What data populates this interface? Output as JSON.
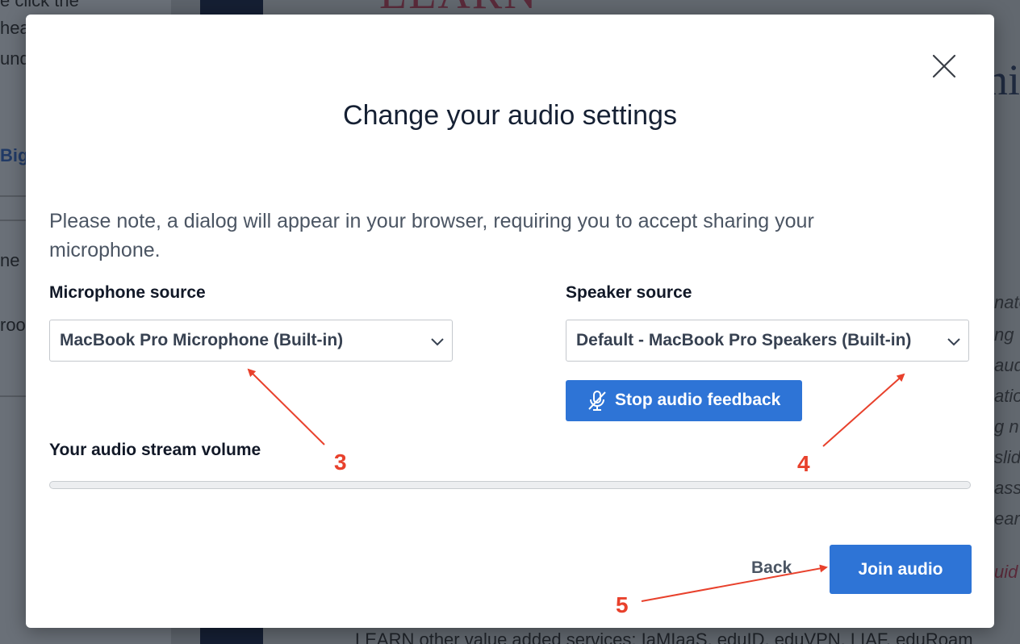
{
  "background": {
    "left_fragments": [
      "e click the",
      "hea",
      "und",
      "BigB",
      "ne n",
      "roo"
    ],
    "logo_fragment": "LEARN",
    "heading_fragment": "ni",
    "right_fragments": [
      "nato",
      "ng",
      "aud",
      "atio",
      "g n",
      "slid",
      "ass",
      "ear",
      "uid"
    ],
    "bottom_text": "LEARN other value added services: IaMIaaS, eduID, eduVPN, LIAF, eduRoam"
  },
  "modal": {
    "title": "Change your audio settings",
    "note": "Please note, a dialog will appear in your browser, requiring you to accept sharing your microphone.",
    "microphone": {
      "label": "Microphone source",
      "selected": "MacBook Pro Microphone (Built-in)"
    },
    "speaker": {
      "label": "Speaker source",
      "selected": "Default - MacBook Pro Speakers (Built-in)"
    },
    "feedback_button": "Stop audio feedback",
    "volume": {
      "label": "Your audio stream volume",
      "level": 0
    },
    "back_label": "Back",
    "join_label": "Join audio"
  },
  "annotations": {
    "color": "#e8412c",
    "labels": [
      "3",
      "4",
      "5"
    ]
  },
  "colors": {
    "accent": "#2e74d6",
    "title": "#152033",
    "text": "#4b5563"
  }
}
